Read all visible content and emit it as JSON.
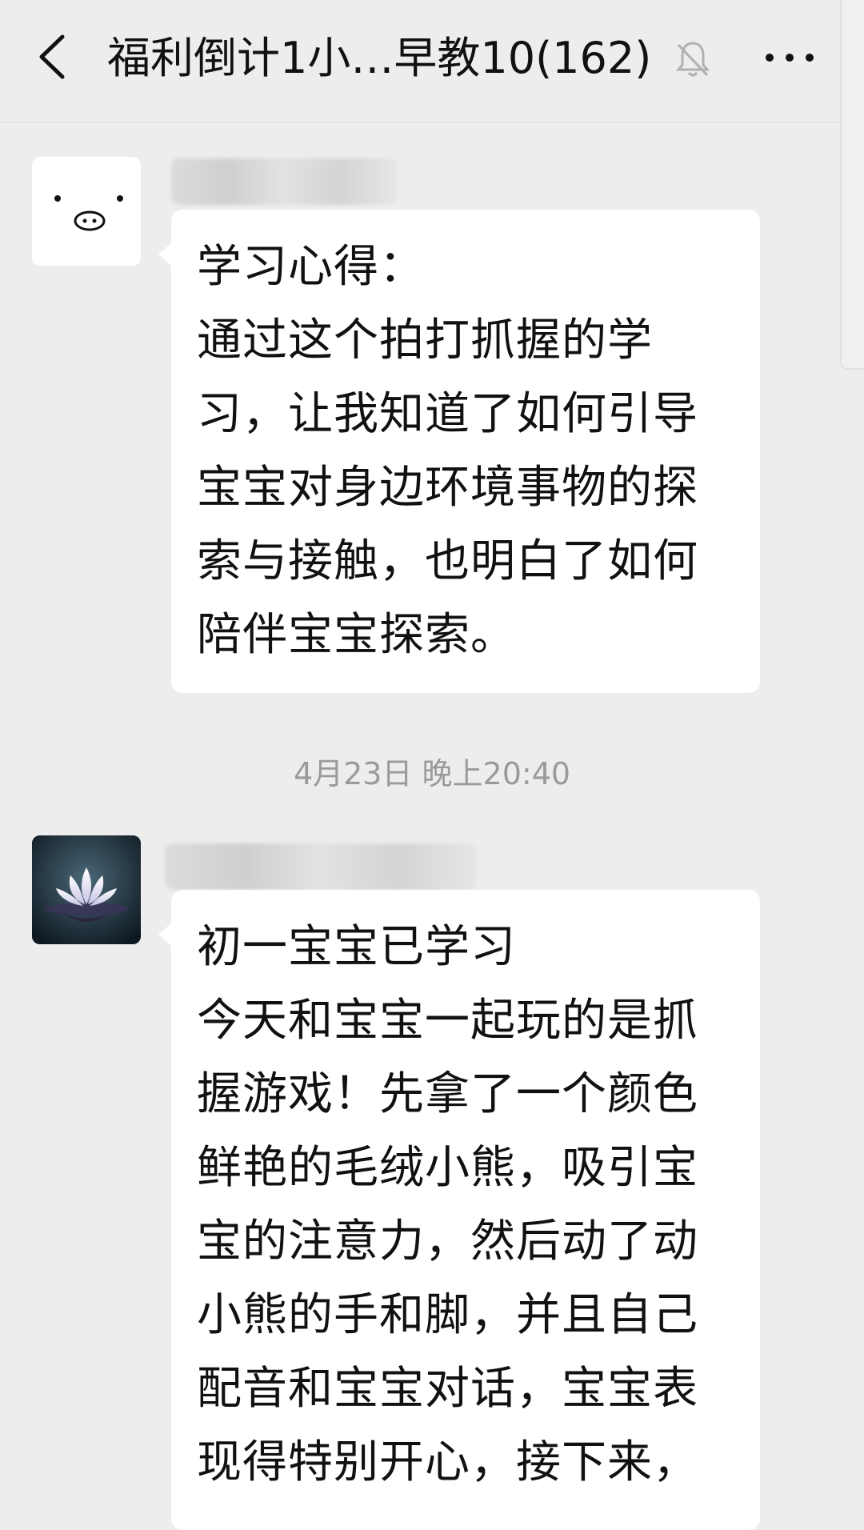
{
  "header": {
    "title": "福利倒计1小…早教10(162)",
    "back_icon": "chevron-left-icon",
    "mute_icon": "bell-off-icon",
    "more_icon": "more-dots-icon"
  },
  "messages": [
    {
      "avatar": "pig-face-avatar",
      "text": "学习心得：\n通过这个拍打抓握的学\n习，让我知道了如何引导\n宝宝对身边环境事物的探\n索与接触，也明白了如何\n陪伴宝宝探索。"
    },
    {
      "avatar": "lotus-flower-avatar",
      "text": "初一宝宝已学习\n今天和宝宝一起玩的是抓\n握游戏！先拿了一个颜色\n鲜艳的毛绒小熊，吸引宝\n宝的注意力，然后动了动\n小熊的手和脚，并且自己\n配音和宝宝对话，宝宝表\n现得特别开心，接下来，"
    }
  ],
  "timestamp": "4月23日 晚上20:40",
  "colors": {
    "background": "#ededed",
    "bubble": "#ffffff",
    "text": "#111111",
    "timestamp": "#9a9a9a"
  }
}
